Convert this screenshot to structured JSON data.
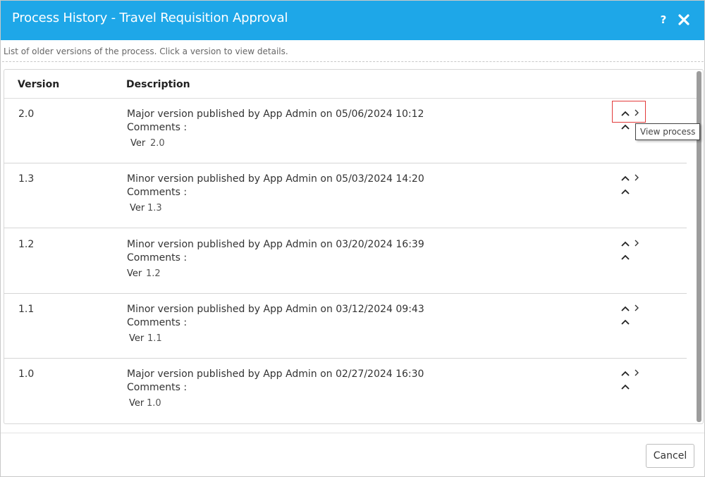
{
  "dialog": {
    "title": "Process History - Travel Requisition Approval",
    "help_label": "?",
    "close_icon": "close-icon",
    "subtitle": "List of older versions of the process. Click a version to view details.",
    "colors": {
      "titlebar": "#1ea7e8",
      "focus_outline": "#e23a3a"
    }
  },
  "table": {
    "headers": {
      "version": "Version",
      "description": "Description"
    },
    "comments_label": "Comments :",
    "ver_label": "Ver",
    "rows": [
      {
        "version": "2.0",
        "description": "Major version published by App Admin on 05/06/2024 10:12",
        "ver": "2.0"
      },
      {
        "version": "1.3",
        "description": "Minor version published by App Admin on 05/03/2024 14:20",
        "ver": "1.3"
      },
      {
        "version": "1.2",
        "description": "Minor version published by App Admin on 03/20/2024 16:39",
        "ver": "1.2"
      },
      {
        "version": "1.1",
        "description": "Minor version published by App Admin on 03/12/2024 09:43",
        "ver": "1.1"
      },
      {
        "version": "1.0",
        "description": "Major version published by App Admin on 02/27/2024 16:30",
        "ver": "1.0"
      }
    ],
    "row_icons": [
      "chevron-up-icon",
      "chevron-right-icon"
    ]
  },
  "tooltip": {
    "text": "View process"
  },
  "footer": {
    "cancel_label": "Cancel"
  }
}
